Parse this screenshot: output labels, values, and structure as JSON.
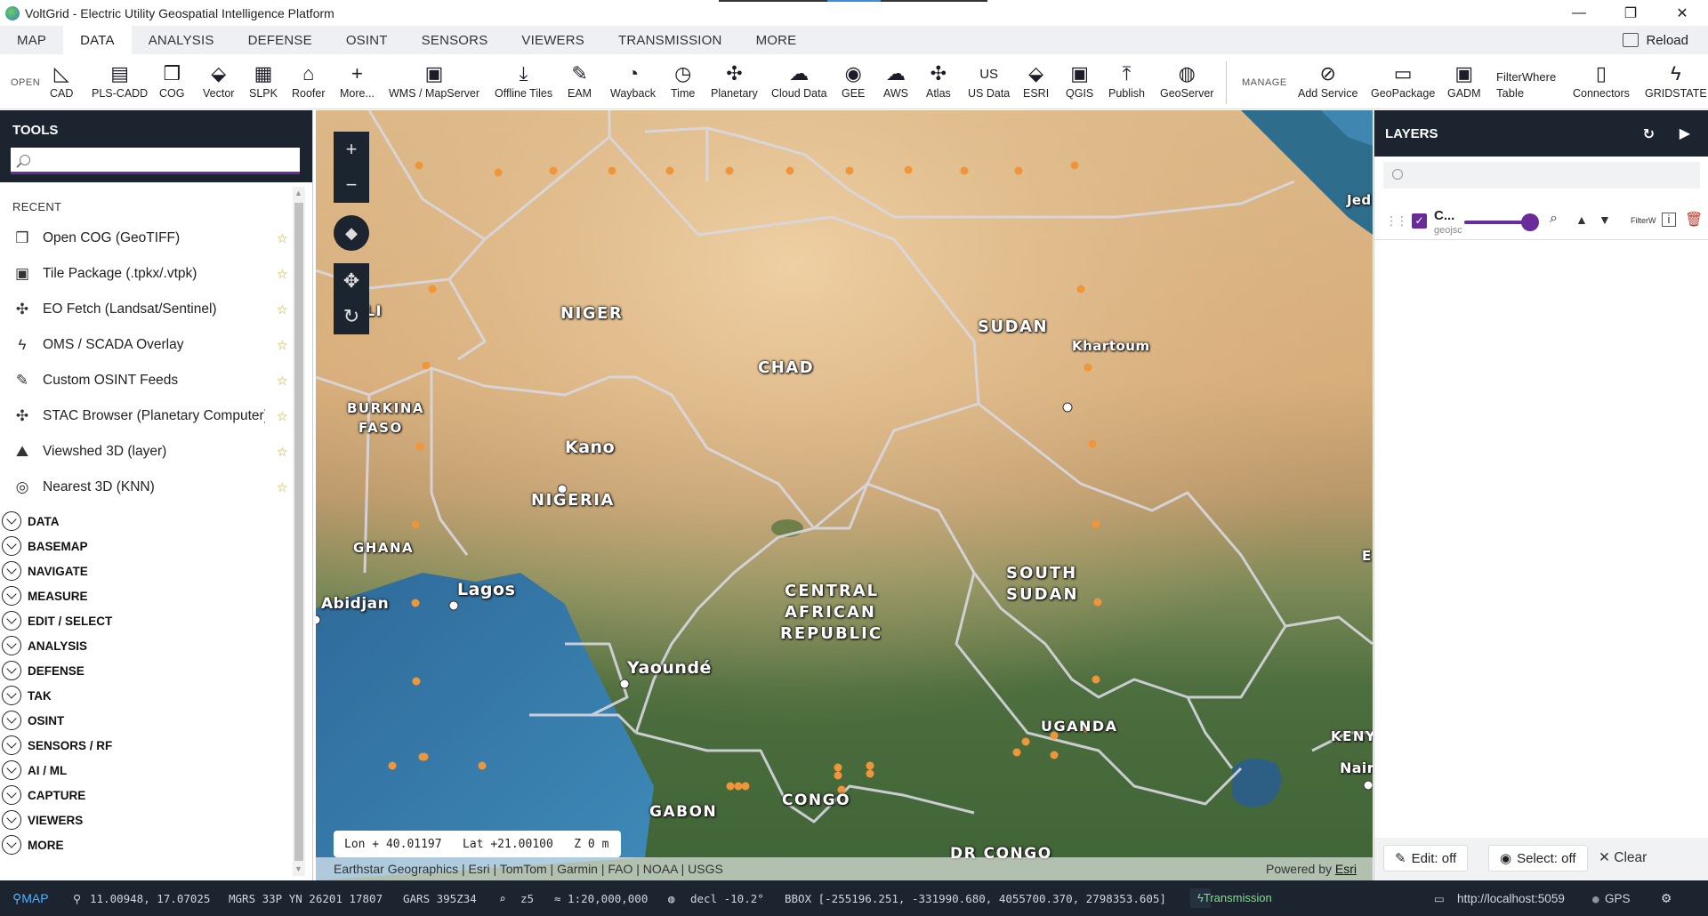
{
  "window": {
    "title": "VoltGrid - Electric Utility Geospatial Intelligence Platform",
    "minimize": "—",
    "restore": "❐",
    "close": "✕"
  },
  "menu": {
    "tabs": [
      "MAP",
      "DATA",
      "ANALYSIS",
      "DEFENSE",
      "OSINT",
      "SENSORS",
      "VIEWERS",
      "TRANSMISSION",
      "MORE"
    ],
    "active": "DATA",
    "reload_label": "Reload"
  },
  "ribbon": {
    "open_label": "OPEN",
    "manage_label": "MANAGE",
    "open_items": [
      {
        "label": "CAD",
        "icon": "cad-icon"
      },
      {
        "label": "PLS-CADD",
        "icon": "pls-cadd-icon"
      },
      {
        "label": "COG",
        "icon": "cog-icon"
      },
      {
        "label": "Vector",
        "icon": "vector-icon"
      },
      {
        "label": "SLPK",
        "icon": "slpk-icon"
      },
      {
        "label": "Roofer",
        "icon": "roofer-icon"
      },
      {
        "label": "More...",
        "icon": "plus-icon"
      },
      {
        "label": "WMS / MapServer",
        "icon": "wms-icon"
      },
      {
        "label": "Offline Tiles",
        "icon": "offline-tiles-icon"
      },
      {
        "label": "EAM",
        "icon": "eam-icon"
      },
      {
        "label": "Wayback",
        "icon": "wayback-icon"
      },
      {
        "label": "Time",
        "icon": "time-icon"
      },
      {
        "label": "Planetary",
        "icon": "planetary-icon"
      },
      {
        "label": "Cloud Data",
        "icon": "cloud-icon"
      },
      {
        "label": "GEE",
        "icon": "globe-icon"
      },
      {
        "label": "AWS",
        "icon": "aws-cloud-icon"
      },
      {
        "label": "Atlas",
        "icon": "atlas-icon"
      },
      {
        "label": "US Data",
        "icon": "us-data-icon"
      },
      {
        "label": "ESRI",
        "icon": "esri-icon"
      },
      {
        "label": "QGIS",
        "icon": "qgis-icon"
      },
      {
        "label": "Publish",
        "icon": "publish-icon"
      },
      {
        "label": "GeoServer",
        "icon": "geoserver-icon"
      }
    ],
    "manage_items": [
      {
        "label": "Add Service",
        "icon": "add-service-icon"
      },
      {
        "label": "GeoPackage",
        "icon": "geopackage-icon"
      },
      {
        "label": "GADM",
        "icon": "gadm-icon"
      },
      {
        "label": "FilterWhere Table",
        "line1": "FilterWhere",
        "line2": "Table"
      },
      {
        "label": "Connectors",
        "icon": "connectors-icon"
      },
      {
        "label": "GRIDSTATE",
        "icon": "bolt-icon"
      }
    ],
    "us_glyph": "US"
  },
  "tools": {
    "title": "TOOLS",
    "search_placeholder": "",
    "recent_heading": "RECENT",
    "recent": [
      {
        "label": "Open COG (GeoTIFF)",
        "icon": "cog-file-icon"
      },
      {
        "label": "Tile Package (.tpkx/.vtpk)",
        "icon": "tile-package-icon"
      },
      {
        "label": "EO Fetch (Landsat/Sentinel)",
        "icon": "satellite-icon"
      },
      {
        "label": "OMS / SCADA Overlay",
        "icon": "bolt-icon"
      },
      {
        "label": "Custom OSINT Feeds",
        "icon": "wrench-icon"
      },
      {
        "label": "STAC Browser (Planetary Computer)",
        "icon": "satellite-icon"
      },
      {
        "label": "Viewshed 3D (layer)",
        "icon": "viewshed-icon"
      },
      {
        "label": "Nearest 3D (KNN)",
        "icon": "target-icon"
      }
    ],
    "categories": [
      "DATA",
      "BASEMAP",
      "NAVIGATE",
      "MEASURE",
      "EDIT / SELECT",
      "ANALYSIS",
      "DEFENSE",
      "TAK",
      "OSINT",
      "SENSORS / RF",
      "AI / ML",
      "CAPTURE",
      "VIEWERS",
      "MORE"
    ]
  },
  "map": {
    "labels": {
      "niger": "NIGER",
      "chad": "CHAD",
      "sudan": "SUDAN",
      "khartoum": "Khartoum",
      "mali": "ALI",
      "burkina1": "BURKINA",
      "burkina2": "FASO",
      "kano": "Kano",
      "nigeria": "NIGERIA",
      "ghana": "GHANA",
      "lagos": "Lagos",
      "abidjan": "Abidjan",
      "car1": "CENTRAL",
      "car2": "AFRICAN",
      "car3": "REPUBLIC",
      "ssudan1": "SOUTH",
      "ssudan2": "SUDAN",
      "yaounde": "Yaoundé",
      "gabon": "GABON",
      "congo": "CONGO",
      "uganda": "UGANDA",
      "kenya": "KENY",
      "nairobi": "Nairo",
      "drcongo": "DR CONGO",
      "jeddah": "Jed",
      "e_edge": "E"
    },
    "zoom_in": "+",
    "zoom_out": "−",
    "compass": "◆",
    "pan": "✥",
    "rotate": "↻",
    "coord_readout": "Lon + 40.01197   Lat +21.00100   Z 0 m",
    "attribution": "Earthstar Geographics | Esri | TomTom | Garmin | FAO | NOAA | USGS",
    "powered_prefix": "Powered by ",
    "powered_link": "Esri",
    "marker_color": "#f0963a"
  },
  "layers": {
    "title": "LAYERS",
    "refresh": "↻",
    "play": "▶",
    "search_placeholder": "",
    "items": [
      {
        "name": "C...",
        "type": "geojsc",
        "visible": true,
        "opacity": 1.0,
        "filter_label": "FilterW"
      }
    ],
    "edit_label": "Edit: off",
    "select_label": "Select: off",
    "clear_label": "Clear"
  },
  "status": {
    "map_badge": "MAP",
    "coords": "11.00948, 17.07025",
    "mgrs": "MGRS 33P YN 26201 17807",
    "gars": "GARS 395Z34",
    "zoom": "z5",
    "scale": "≈ 1:20,000,000",
    "decl": "decl -10.2°",
    "bbox": "BBOX [-255196.251, -331990.680, 4055700.370, 2798353.605]",
    "transmission": "Transmission",
    "url": "http://localhost:5059",
    "gps": "GPS"
  },
  "colors": {
    "accent": "#6a2c9a",
    "panel_dark": "#1c2430",
    "marker": "#f0963a"
  }
}
